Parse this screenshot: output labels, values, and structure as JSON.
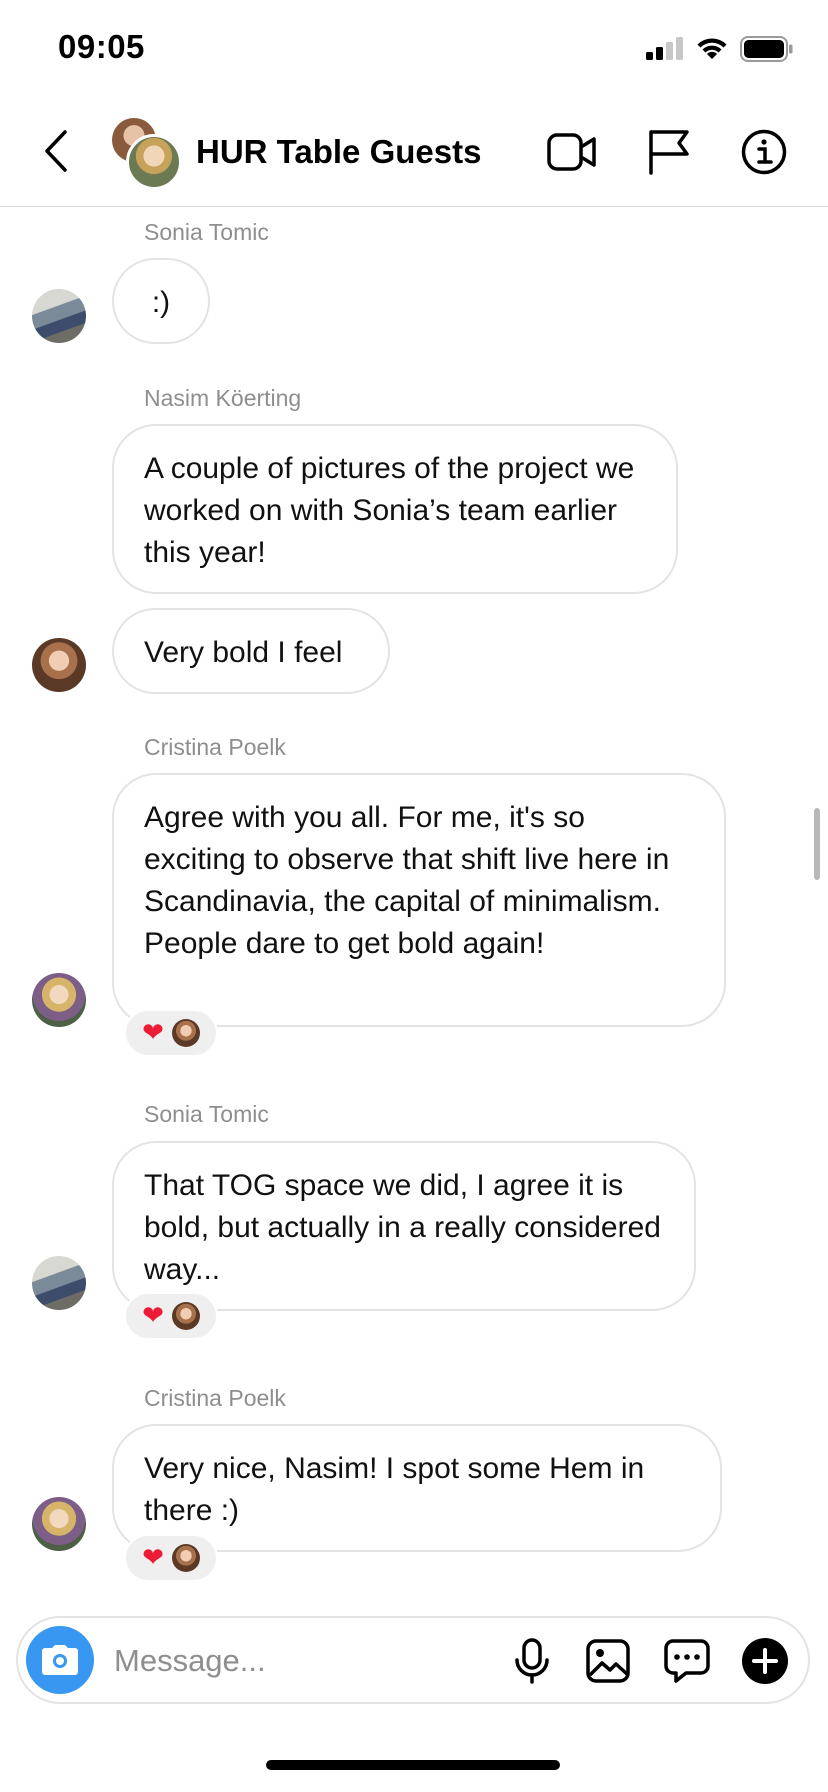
{
  "status_bar": {
    "time": "09:05",
    "icons": [
      "cellular-signal-icon",
      "wifi-icon",
      "battery-icon"
    ]
  },
  "header": {
    "title": "HUR Table Guests",
    "actions": [
      "video-call-icon",
      "flag-icon",
      "info-icon"
    ]
  },
  "messages": [
    {
      "sender": "Sonia Tomic",
      "text": ":)"
    },
    {
      "sender": "Nasim Köerting",
      "text": "A couple of pictures of the project we worked on with Sonia’s team earlier this year!"
    },
    {
      "sender": "Nasim Köerting",
      "text": "Very bold I feel"
    },
    {
      "sender": "Cristina Poelk",
      "text": "Agree with you all. For me, it's so exciting to observe that shift live here in Scandinavia, the capital of minimalism. People dare  to get bold again!",
      "reaction": "❤"
    },
    {
      "sender": "Sonia Tomic",
      "text": "That TOG space we did, I agree it is bold, but actually in a really considered way...",
      "reaction": "❤"
    },
    {
      "sender": "Cristina Poelk",
      "text": "Very nice, Nasim! I spot some Hem in there :)",
      "reaction": "❤"
    }
  ],
  "composer": {
    "placeholder": "Message...",
    "value": "",
    "actions": [
      "microphone-icon",
      "gallery-icon",
      "chat-bubble-icon",
      "plus-icon"
    ]
  },
  "colors": {
    "accent_blue": "#3897f0",
    "bubble_border": "#e3e3e3",
    "sender_gray": "#8e8e8e",
    "heart_red": "#ed1c36"
  }
}
